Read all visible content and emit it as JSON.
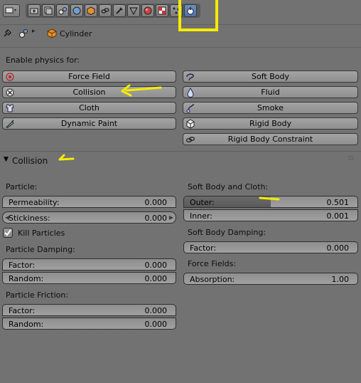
{
  "header": {
    "icons": [
      "render-icon",
      "render-layers-icon",
      "scene-icon",
      "world-icon",
      "object-icon",
      "constraints-icon",
      "modifiers-icon",
      "object-data-icon",
      "material-icon",
      "texture-icon",
      "particles-icon",
      "physics-icon"
    ],
    "accent": "#4a72ad"
  },
  "context": {
    "object_name": "Cylinder"
  },
  "enable_physics": {
    "label": "Enable physics for:",
    "left": [
      {
        "label": "Force Field",
        "icon": "force-field-icon"
      },
      {
        "label": "Collision",
        "icon": "collision-icon"
      },
      {
        "label": "Cloth",
        "icon": "cloth-icon"
      },
      {
        "label": "Dynamic Paint",
        "icon": "dynamic-paint-icon"
      }
    ],
    "right": [
      {
        "label": "Soft Body",
        "icon": "soft-body-icon"
      },
      {
        "label": "Fluid",
        "icon": "fluid-icon"
      },
      {
        "label": "Smoke",
        "icon": "smoke-icon"
      },
      {
        "label": "Rigid Body",
        "icon": "rigid-body-icon"
      },
      {
        "label": "Rigid Body Constraint",
        "icon": "rigid-body-constraint-icon"
      }
    ]
  },
  "collision_panel": {
    "title": "Collision",
    "particle": {
      "heading": "Particle:",
      "permeability": {
        "label": "Permeability:",
        "value": "0.000"
      },
      "stickiness": {
        "label": "Stickiness:",
        "value": "0.000"
      },
      "kill_particles": {
        "label": "Kill Particles",
        "checked": true
      }
    },
    "particle_damping": {
      "heading": "Particle Damping:",
      "factor": {
        "label": "Factor:",
        "value": "0.000"
      },
      "random": {
        "label": "Random:",
        "value": "0.000"
      }
    },
    "particle_friction": {
      "heading": "Particle Friction:",
      "factor": {
        "label": "Factor:",
        "value": "0.000"
      },
      "random": {
        "label": "Random:",
        "value": "0.000"
      }
    },
    "soft_body_cloth": {
      "heading": "Soft Body and Cloth:",
      "outer": {
        "label": "Outer:",
        "value": "0.501",
        "fill_fraction": 0.501
      },
      "inner": {
        "label": "Inner:",
        "value": "0.001"
      }
    },
    "soft_body_damping": {
      "heading": "Soft Body Damping:",
      "factor": {
        "label": "Factor:",
        "value": "0.000"
      }
    },
    "force_fields": {
      "heading": "Force Fields:",
      "absorption": {
        "label": "Absorption:",
        "value": "1.00"
      }
    }
  },
  "annotation_color": "#f5ec00"
}
